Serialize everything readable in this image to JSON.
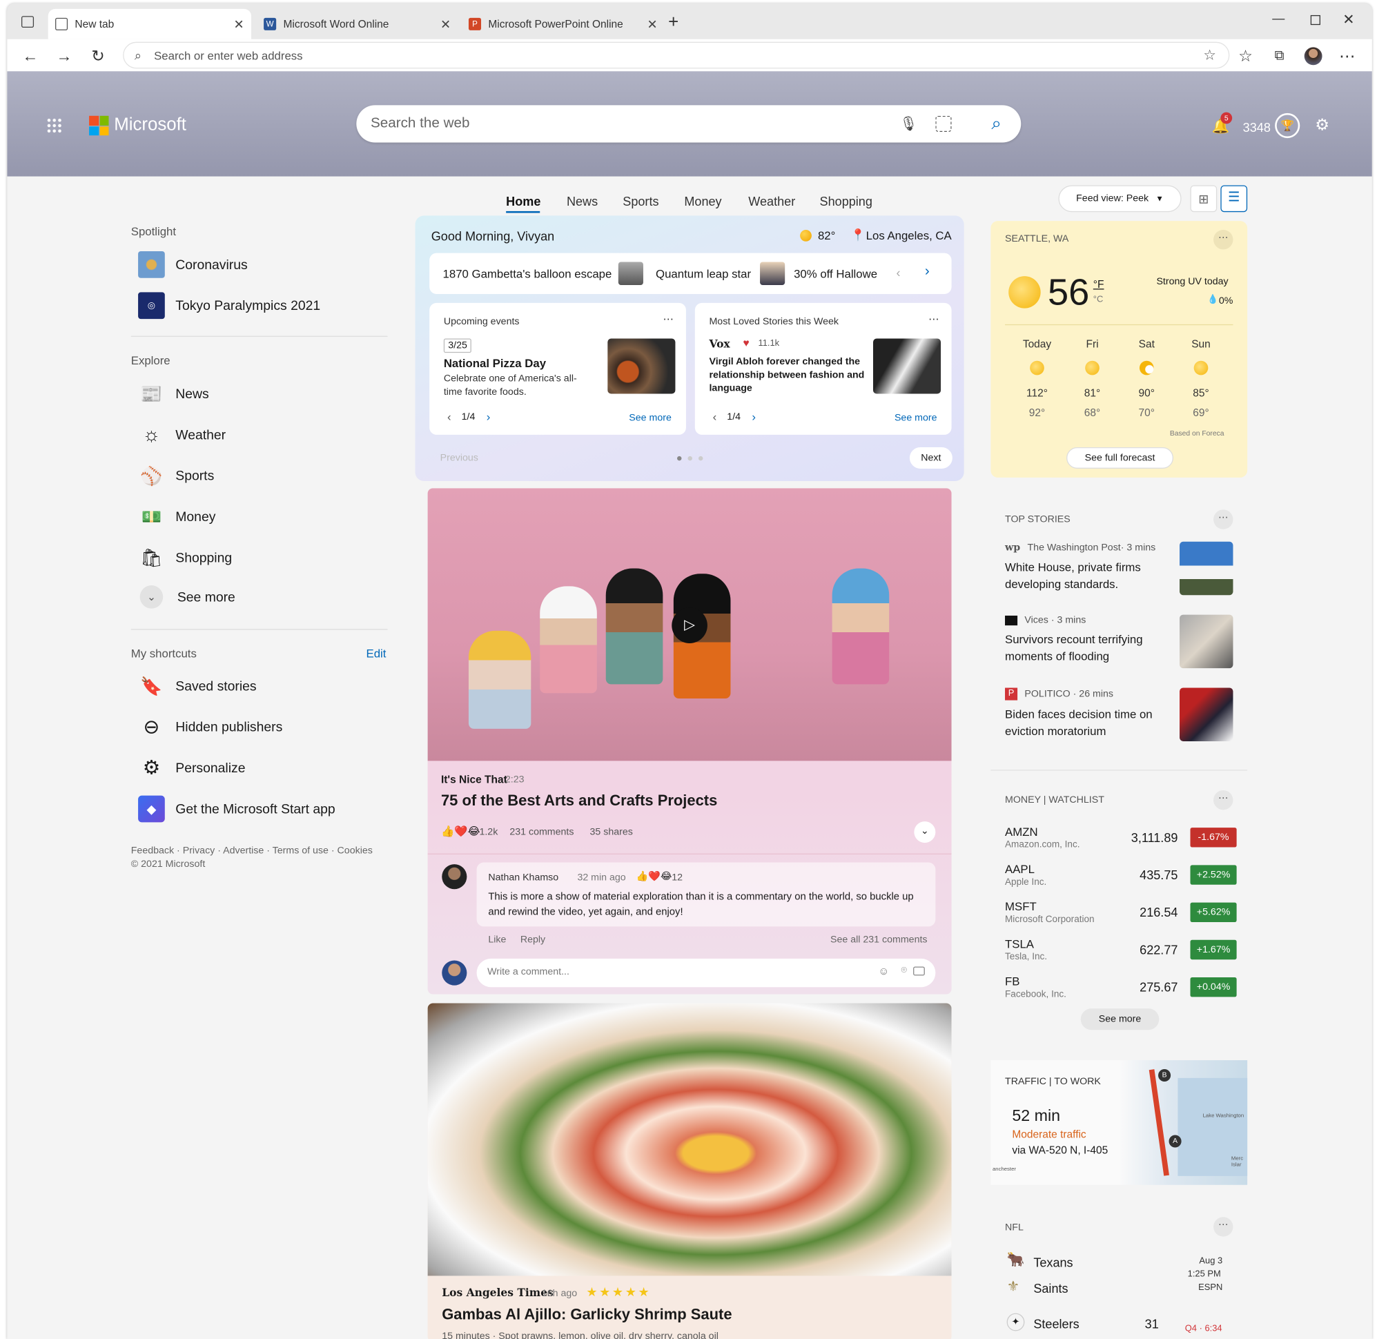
{
  "browser": {
    "tabs": [
      {
        "label": "New tab",
        "active": true
      },
      {
        "label": "Microsoft Word Online",
        "active": false
      },
      {
        "label": "Microsoft PowerPoint Online",
        "active": false
      }
    ],
    "address_placeholder": "Search or enter web address"
  },
  "header": {
    "brand": "Microsoft",
    "search_placeholder": "Search the web",
    "notification_count": "5",
    "points": "3348"
  },
  "nav": {
    "tabs": [
      "Home",
      "News",
      "Sports",
      "Money",
      "Weather",
      "Shopping"
    ],
    "active_tab": "Home",
    "feed_view": "Feed view: Peek"
  },
  "sidebar": {
    "spotlight_title": "Spotlight",
    "spotlight": [
      "Coronavirus",
      "Tokyo Paralympics 2021"
    ],
    "explore_title": "Explore",
    "explore": [
      {
        "label": "News",
        "icon": "news-icon"
      },
      {
        "label": "Weather",
        "icon": "weather-icon"
      },
      {
        "label": "Sports",
        "icon": "sports-icon"
      },
      {
        "label": "Money",
        "icon": "money-icon"
      },
      {
        "label": "Shopping",
        "icon": "shopping-icon"
      },
      {
        "label": "See more",
        "icon": "chevron-down-icon"
      }
    ],
    "shortcuts_title": "My shortcuts",
    "edit_label": "Edit",
    "shortcuts": [
      {
        "label": "Saved stories",
        "icon": "bookmark-icon"
      },
      {
        "label": "Hidden publishers",
        "icon": "minus-circle-icon"
      },
      {
        "label": "Personalize",
        "icon": "gear-icon"
      },
      {
        "label": "Get the Microsoft Start app",
        "icon": "app-icon"
      }
    ],
    "footer_links": "Feedback · Privacy · Advertise · Terms of use · Cookies",
    "copyright": "© 2021 Microsoft"
  },
  "greeting": {
    "text": "Good Morning, Vivyan",
    "temp": "82°",
    "location": "Los Angeles, CA",
    "ticker": [
      "1870 Gambetta's balloon escape",
      "Quantum leap star",
      "30% off Hallowe"
    ]
  },
  "events_card": {
    "title": "Upcoming events",
    "date": "3/25",
    "headline": "National Pizza Day",
    "desc": "Celebrate one of America's all-time favorite foods.",
    "pager": "1/4",
    "see_more": "See more"
  },
  "loved_card": {
    "title": "Most Loved Stories this Week",
    "source": "Vox",
    "likes": "11.1k",
    "headline": "Virgil Abloh forever changed the relationship between fashion and language",
    "pager": "1/4",
    "see_more": "See more"
  },
  "carousel": {
    "previous": "Previous",
    "next": "Next"
  },
  "video_card": {
    "source": "It's Nice That",
    "duration": "2:23",
    "title": "75 of the Best Arts and Crafts Projects",
    "reactions": "1.2k",
    "comments": "231 comments",
    "shares": "35 shares",
    "comment_author": "Nathan Khamso",
    "comment_time": "32 min ago",
    "comment_reactions": "12",
    "comment_text": "This is more a show of material exploration than it is a commentary on the world, so buckle up and rewind the video, yet again, and enjoy!",
    "like": "Like",
    "reply": "Reply",
    "see_all": "See all 231 comments",
    "write_placeholder": "Write a comment..."
  },
  "recipe_card": {
    "source": "Los Angeles Times",
    "time": "16h ago",
    "title": "Gambas Al Ajillo: Garlicky Shrimp Saute",
    "meta": "15 minutes · Spot prawns, lemon, olive oil, dry sherry, canola oil",
    "rating": 5
  },
  "weather": {
    "location": "SEATTLE, WA",
    "temp": "56",
    "unit_f": "°F",
    "unit_c": "°C",
    "uv": "Strong UV today",
    "precip": "0%",
    "days": [
      {
        "day": "Today",
        "hi": "112°",
        "lo": "92°"
      },
      {
        "day": "Fri",
        "hi": "81°",
        "lo": "68°"
      },
      {
        "day": "Sat",
        "hi": "90°",
        "lo": "70°"
      },
      {
        "day": "Sun",
        "hi": "85°",
        "lo": "69°"
      }
    ],
    "credit": "Based on Foreca",
    "forecast_btn": "See full forecast"
  },
  "top_stories": {
    "title": "TOP STORIES",
    "items": [
      {
        "source": "The Washington Post· 3 mins",
        "headline": "White House, private firms developing standards."
      },
      {
        "source": "Vices · 3 mins",
        "headline": "Survivors recount terrifying moments of flooding"
      },
      {
        "source": "POLITICO · 26 mins",
        "headline": "Biden faces decision time on eviction moratorium"
      }
    ]
  },
  "watchlist": {
    "title": "MONEY | WATCHLIST",
    "stocks": [
      {
        "symbol": "AMZN",
        "company": "Amazon.com, Inc.",
        "price": "3,111.89",
        "change": "-1.67%",
        "color": "#c4312b"
      },
      {
        "symbol": "AAPL",
        "company": "Apple Inc.",
        "price": "435.75",
        "change": "+2.52%",
        "color": "#2e8b3e"
      },
      {
        "symbol": "MSFT",
        "company": "Microsoft Corporation",
        "price": "216.54",
        "change": "+5.62%",
        "color": "#2e8b3e"
      },
      {
        "symbol": "TSLA",
        "company": "Tesla, Inc.",
        "price": "622.77",
        "change": "+1.67%",
        "color": "#2e8b3e"
      },
      {
        "symbol": "FB",
        "company": "Facebook, Inc.",
        "price": "275.67",
        "change": "+0.04%",
        "color": "#2e8b3e"
      }
    ],
    "see_more": "See more"
  },
  "traffic": {
    "title": "TRAFFIC | TO WORK",
    "time": "52 min",
    "status": "Moderate traffic",
    "route": "via WA-520 N, I-405",
    "map_label_1": "Lake Washington",
    "map_label_2": "anchester",
    "map_label_3": "Merc Islar"
  },
  "nfl": {
    "title": "NFL",
    "game1": {
      "team1": "Texans",
      "team2": "Saints",
      "date": "Aug 3",
      "time": "1:25 PM",
      "network": "ESPN"
    },
    "game2": {
      "team1": "Steelers",
      "score1": "31",
      "status": "Q4 · 6:34"
    }
  }
}
